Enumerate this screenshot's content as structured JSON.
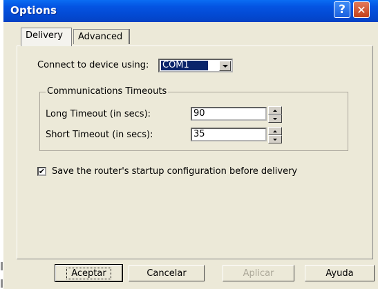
{
  "window": {
    "title": "Options",
    "help_glyph": "?",
    "close_glyph": "✕"
  },
  "tabs": [
    {
      "label": "Delivery",
      "selected": true
    },
    {
      "label": "Advanced",
      "selected": false
    }
  ],
  "delivery": {
    "connect_label": "Connect to device using:",
    "connect_value": "COM1",
    "group_title": "Communications Timeouts",
    "long_label": "Long Timeout (in secs):",
    "long_value": "90",
    "short_label": "Short Timeout (in secs):",
    "short_value": "35",
    "save_label": "Save the router's startup configuration before delivery",
    "save_checked": true,
    "check_glyph": "✔"
  },
  "buttons": {
    "ok": "Aceptar",
    "cancel": "Cancelar",
    "apply": "Aplicar",
    "help": "Ayuda"
  },
  "icons": {
    "help": "help-icon",
    "close": "close-icon",
    "dropdown": "chevron-down-icon",
    "spin_up": "arrow-up-icon",
    "spin_down": "arrow-down-icon",
    "check": "checkmark-icon"
  },
  "colors": {
    "titlebar": "#0454e2",
    "selection": "#0a246a",
    "dialog_bg": "#ece9d8",
    "close_button": "#c3401a",
    "disabled_text": "#aca899"
  }
}
